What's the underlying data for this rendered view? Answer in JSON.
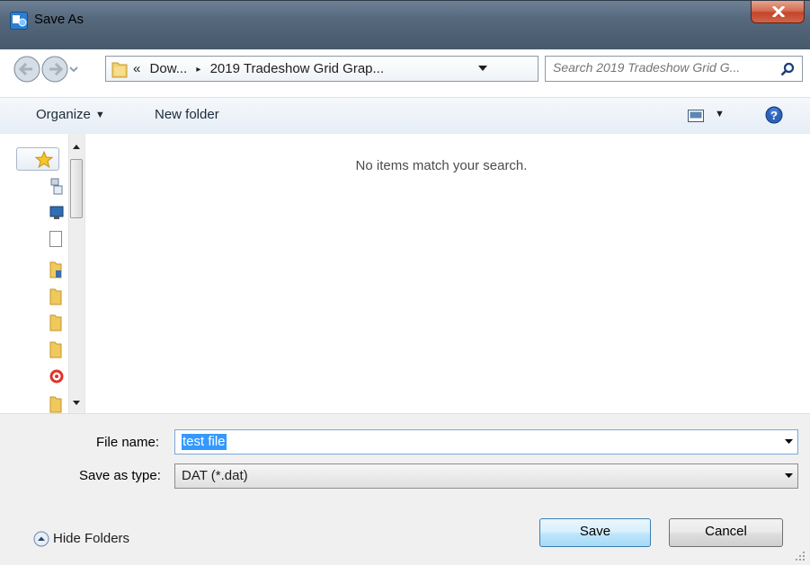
{
  "window": {
    "title": "Save As",
    "icon": "save-as-app-icon",
    "close_icon": "close-icon"
  },
  "address": {
    "overflow": "«",
    "path": [
      "Dow...",
      "2019 Tradeshow Grid Grap..."
    ],
    "separator": "▸",
    "back_icon": "back-arrow-icon",
    "forward_icon": "forward-arrow-icon",
    "refresh_icon": "refresh-icon"
  },
  "search": {
    "placeholder": "Search 2019 Tradeshow Grid G...",
    "icon": "search-icon"
  },
  "toolbar": {
    "organize_label": "Organize",
    "new_folder_label": "New folder",
    "views_icon": "views-icon",
    "help_icon": "help-icon"
  },
  "content": {
    "empty_message": "No items match your search."
  },
  "form": {
    "file_name_label": "File name:",
    "file_name_value": "test file",
    "save_type_label": "Save as type:",
    "save_type_value": "DAT (*.dat)"
  },
  "footer": {
    "hide_folders_label": "Hide Folders",
    "save_label": "Save",
    "cancel_label": "Cancel"
  },
  "colors": {
    "selection": "#3399ff",
    "close_button": "#c4452a",
    "titlebar": "#56697d"
  }
}
